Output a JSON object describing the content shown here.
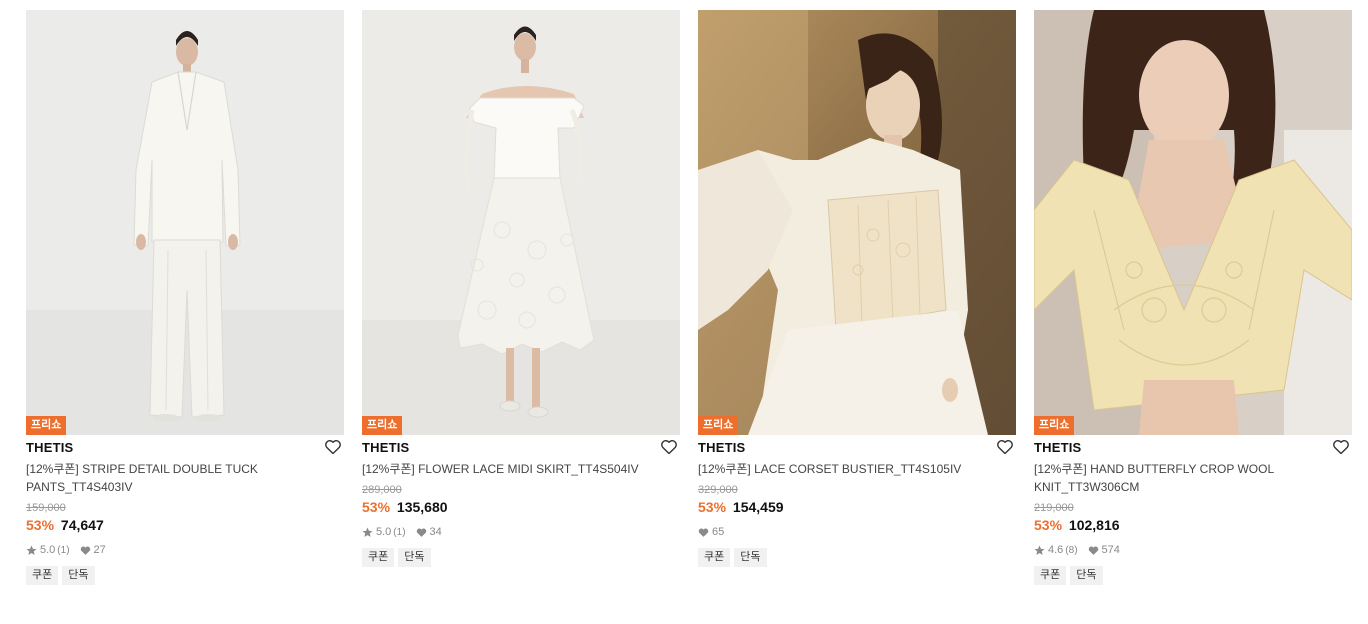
{
  "products": [
    {
      "badge": "프리쇼",
      "brand": "THETIS",
      "name": "[12%쿠폰] STRIPE DETAIL DOUBLE TUCK PANTS_TT4S403IV",
      "original_price": "159,000",
      "discount": "53%",
      "price": "74,647",
      "rating": "5.0",
      "rating_count": "(1)",
      "likes": "27",
      "tags": [
        "쿠폰",
        "단독"
      ],
      "image_alt": "model in white blazer and wide white trousers"
    },
    {
      "badge": "프리쇼",
      "brand": "THETIS",
      "name": "[12%쿠폰] FLOWER LACE MIDI SKIRT_TT4S504IV",
      "original_price": "289,000",
      "discount": "53%",
      "price": "135,680",
      "rating": "5.0",
      "rating_count": "(1)",
      "likes": "34",
      "tags": [
        "쿠폰",
        "단독"
      ],
      "image_alt": "model in off-shoulder white top and lace midi skirt"
    },
    {
      "badge": "프리쇼",
      "brand": "THETIS",
      "name": "[12%쿠폰] LACE CORSET BUSTIER_TT4S105IV",
      "original_price": "329,000",
      "discount": "53%",
      "price": "154,459",
      "rating": "",
      "rating_count": "",
      "likes": "65",
      "tags": [
        "쿠폰",
        "단독"
      ],
      "image_alt": "model in white shirt with lace corset bustier"
    },
    {
      "badge": "프리쇼",
      "brand": "THETIS",
      "name": "[12%쿠폰] HAND BUTTERFLY CROP WOOL KNIT_TT3W306CM",
      "original_price": "219,000",
      "discount": "53%",
      "price": "102,816",
      "rating": "4.6",
      "rating_count": "(8)",
      "likes": "574",
      "tags": [
        "쿠폰",
        "단독"
      ],
      "image_alt": "model in cream crochet butterfly crop knit"
    }
  ],
  "colors": {
    "accent": "#ee6f2d",
    "muted": "#999999",
    "tag_bg": "#f1f1f1"
  }
}
